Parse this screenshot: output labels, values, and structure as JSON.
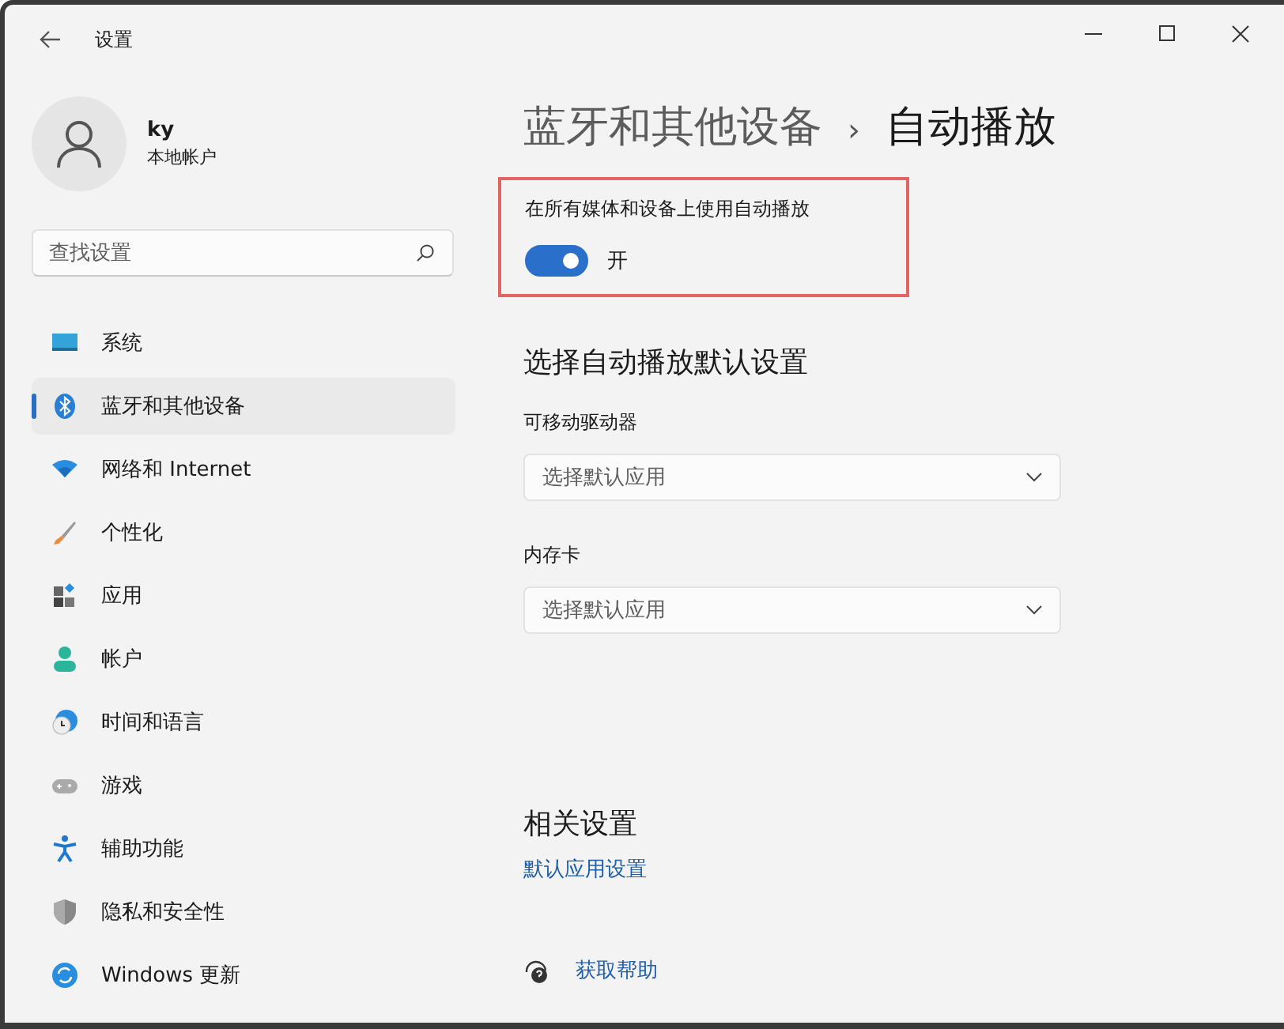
{
  "window": {
    "title": "设置"
  },
  "user": {
    "name": "ky",
    "account": "本地帐户"
  },
  "search": {
    "placeholder": "查找设置"
  },
  "sidebar": {
    "items": [
      {
        "label": "系统",
        "selected": false
      },
      {
        "label": "蓝牙和其他设备",
        "selected": true
      },
      {
        "label": "网络和 Internet",
        "selected": false
      },
      {
        "label": "个性化",
        "selected": false
      },
      {
        "label": "应用",
        "selected": false
      },
      {
        "label": "帐户",
        "selected": false
      },
      {
        "label": "时间和语言",
        "selected": false
      },
      {
        "label": "游戏",
        "selected": false
      },
      {
        "label": "辅助功能",
        "selected": false
      },
      {
        "label": "隐私和安全性",
        "selected": false
      },
      {
        "label": "Windows 更新",
        "selected": false
      }
    ]
  },
  "breadcrumb": {
    "parent": "蓝牙和其他设备",
    "separator": "›",
    "current": "自动播放"
  },
  "autoplay": {
    "label": "在所有媒体和设备上使用自动播放",
    "on": true,
    "state_text": "开",
    "highlighted": true
  },
  "defaults": {
    "heading": "选择自动播放默认设置",
    "fields": [
      {
        "label": "可移动驱动器",
        "placeholder": "选择默认应用"
      },
      {
        "label": "内存卡",
        "placeholder": "选择默认应用"
      }
    ]
  },
  "related": {
    "heading": "相关设置",
    "link": "默认应用设置"
  },
  "help": {
    "link": "获取帮助"
  }
}
